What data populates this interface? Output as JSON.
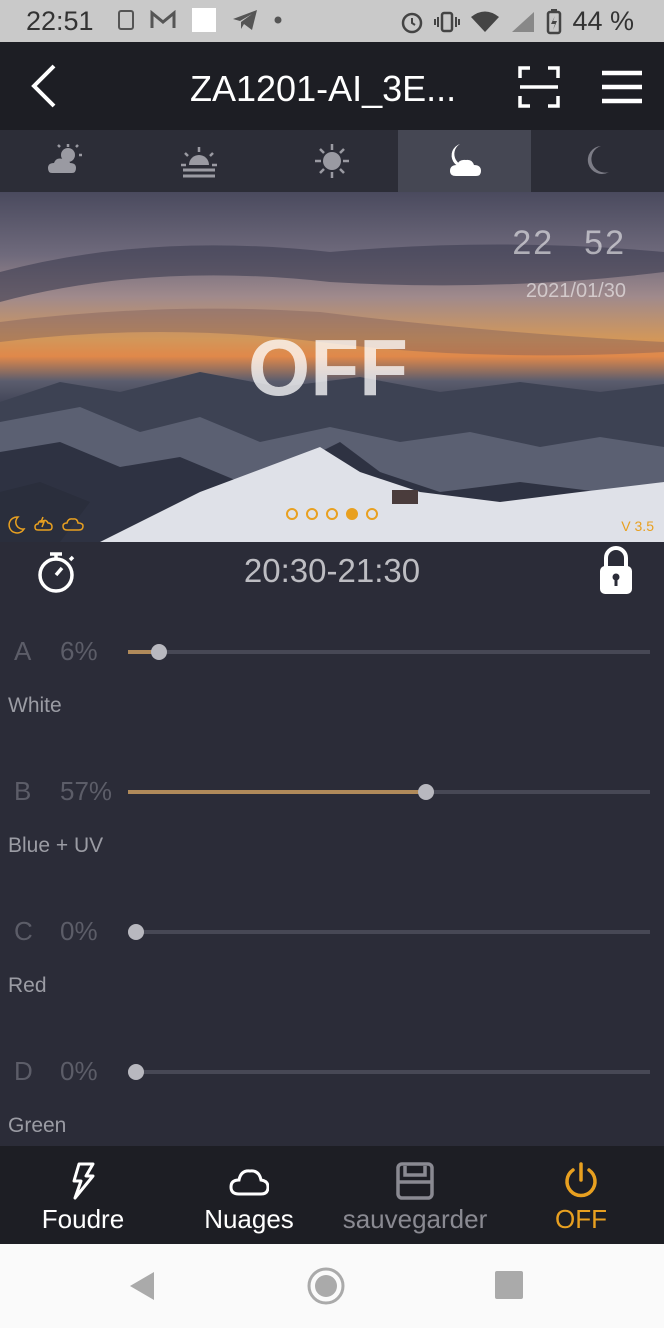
{
  "status_bar": {
    "time": "22:51",
    "battery": "44 %"
  },
  "header": {
    "title": "ZA1201-AI_3E..."
  },
  "mode_tabs": [
    {
      "name": "cloudy-sun",
      "active": false
    },
    {
      "name": "sunrise",
      "active": false
    },
    {
      "name": "sun",
      "active": false
    },
    {
      "name": "moon-cloud",
      "active": true
    },
    {
      "name": "moon",
      "active": false
    }
  ],
  "hero": {
    "clock_hour": "22",
    "clock_minute": "52",
    "date": "2021/01/30",
    "state": "OFF",
    "version": "V 3.5",
    "page_dots": 5,
    "active_dot": 4
  },
  "timer": {
    "range": "20:30-21:30"
  },
  "channels": [
    {
      "letter": "A",
      "percent_label": "6%",
      "value": 6,
      "name": "White"
    },
    {
      "letter": "B",
      "percent_label": "57%",
      "value": 57,
      "name": "Blue + UV"
    },
    {
      "letter": "C",
      "percent_label": "0%",
      "value": 0,
      "name": "Red"
    },
    {
      "letter": "D",
      "percent_label": "0%",
      "value": 0,
      "name": "Green"
    }
  ],
  "bottom_bar": {
    "lightning": {
      "label": "Foudre",
      "color": "#ffffff"
    },
    "clouds": {
      "label": "Nuages",
      "color": "#ffffff"
    },
    "save": {
      "label": "sauvegarder",
      "color": "#8a8a92"
    },
    "power": {
      "label": "OFF",
      "color": "#e8a020"
    }
  },
  "colors": {
    "accent": "#e8a020",
    "background": "#2b2c38",
    "header": "#1d1e24"
  }
}
